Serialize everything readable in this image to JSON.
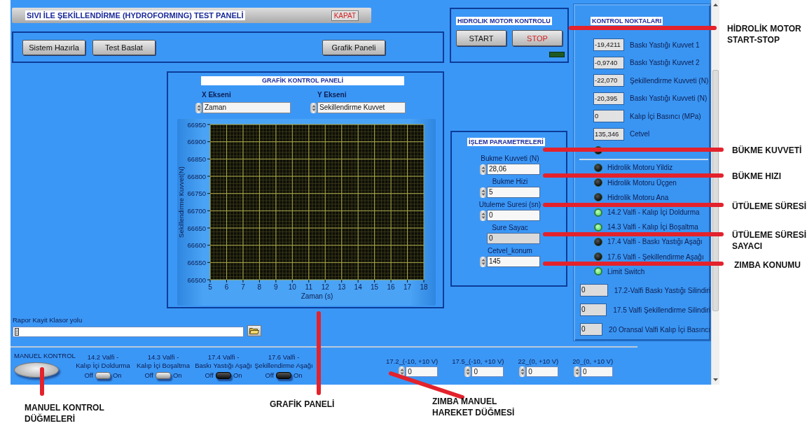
{
  "title_bar": {
    "title": "SIVI İLE ŞEKİLLENDİRME (HYDROFORMING) TEST PANELİ",
    "close_button": "KAPAT"
  },
  "toolbar_buttons": [
    "Sistem Hazırla",
    "Test Baslat",
    "Grafik Paneli"
  ],
  "motor_control": {
    "title": "HIDROLIK MOTOR KONTROLU",
    "start": "START",
    "stop": "STOP",
    "led_on": false
  },
  "control_points": {
    "title": "KONTROL NOKTALARI",
    "readouts": [
      {
        "value": "-19,4211",
        "label": "Baskı Yastığı Kuvvet 1"
      },
      {
        "value": "-0,9740",
        "label": "Baskı Yastığı Kuvvet 2"
      },
      {
        "value": "-22,070",
        "label": "Şekillendirme Kuvveti (N)"
      },
      {
        "value": "-20,395",
        "label": "Baskı Yastığı Kuvveti (N)"
      },
      {
        "value": "0",
        "label": "Kalıp İçi Basıncı (MPa)"
      },
      {
        "value": "135,346",
        "label": "Cetvel"
      }
    ],
    "first_lamp": {
      "on": false
    },
    "lamps": [
      {
        "label": "Hidrolik Motoru Yildiz",
        "on": false
      },
      {
        "label": "Hidrolik Motoru Üçgen",
        "on": false
      },
      {
        "label": "Hidrolik Motoru Ana",
        "on": false
      },
      {
        "label": "14.2 Valfi - Kalıp İçi Doldurma",
        "on": true
      },
      {
        "label": "14.3 Valfi - Kalıp İçi Boşaltma",
        "on": true
      },
      {
        "label": "17.4 Valfi - Baskı Yastığı Aşağı",
        "on": false
      },
      {
        "label": "17.6 Valfi - Şekillendirme Aşağı",
        "on": false
      },
      {
        "label": "Limit Switch",
        "on": true
      }
    ],
    "indicators": [
      {
        "value": "0",
        "label": "17.2-Valfi Baskı Yastığı Silindiri"
      },
      {
        "value": "0",
        "label": "17.5 Valfi Şekillendirme Silindiri"
      },
      {
        "value": "0",
        "label": "20 Oransal Valfi Kalıp İçi Basıncı"
      }
    ]
  },
  "graph_panel": {
    "title": "GRAFİK KONTROL PANELİ",
    "x_axis": {
      "label": "X Ekseni",
      "value": "Zaman"
    },
    "y_axis": {
      "label": "Y Ekseni",
      "value": "Sekillendirme Kuvvet"
    },
    "chart_data": {
      "type": "line",
      "grid": true,
      "xlabel": "Zaman (s)",
      "ylabel": "Sekillendirme Kuvvet(N)",
      "xlim": [
        5,
        18
      ],
      "ylim": [
        66500,
        66950
      ],
      "xticks": [
        5,
        6,
        7,
        8,
        9,
        10,
        11,
        12,
        13,
        14,
        15,
        16,
        17,
        18
      ],
      "yticks": [
        66500,
        66550,
        66600,
        66650,
        66700,
        66750,
        66800,
        66850,
        66900,
        66950
      ]
    }
  },
  "process_parameters": {
    "title": "İŞLEM PARAMETRELERİ",
    "fields": [
      {
        "label": "Bukme Kuvveti (N)",
        "value": "28,06",
        "kind": "control"
      },
      {
        "label": "Bukme Hizi",
        "value": "5",
        "kind": "control"
      },
      {
        "label": "Utuleme Suresi (sn)",
        "value": "0",
        "kind": "control"
      },
      {
        "label": "Sure Sayac",
        "value": "0",
        "kind": "indicator"
      },
      {
        "label": "Cetvel_konum",
        "value": "145",
        "kind": "control"
      }
    ]
  },
  "report_path": {
    "label": "Rapor Kayit Klasor yolu"
  },
  "manual_control": {
    "label": "MANUEL KONTROL",
    "switches": [
      {
        "label": "14.2 Valfi -\nKalıp İçi Doldurma",
        "off_label": "Off",
        "on_label": "On",
        "on": true
      },
      {
        "label": "14.3 Valfi -\nKalıp İçi Boşaltma",
        "off_label": "Off",
        "on_label": "On",
        "on": true
      },
      {
        "label": "17.4 Valfi -\nBaskı Yastığı Aşağı",
        "off_label": "Off",
        "on_label": "On",
        "on": false
      },
      {
        "label": "17.6 Valfi -\nŞekillendirme Aşağı",
        "off_label": "Off",
        "on_label": "On",
        "on": false
      }
    ]
  },
  "analog_outputs": [
    {
      "label": "17.2_(-10, +10 V)",
      "value": "0"
    },
    {
      "label": "17.5_(-10, +10 V)",
      "value": "0"
    },
    {
      "label": "22_(0, +10 V)",
      "value": "0"
    },
    {
      "label": "20_(0, +10 V)",
      "value": "0"
    }
  ],
  "annotations": [
    {
      "text": "HİDROLİK MOTOR\nSTART-STOP"
    },
    {
      "text": "BÜKME KUVVETİ"
    },
    {
      "text": "BÜKME HIZI"
    },
    {
      "text": "ÜTÜLEME SÜRESİ"
    },
    {
      "text": "ÜTÜLEME SÜRESİ\nSAYACI"
    },
    {
      "text": "ZIMBA KONUMU"
    },
    {
      "text": "GRAFİK PANELİ"
    },
    {
      "text": "MANUEL KONTROL\nDÜĞMELERİ"
    },
    {
      "text": "ZIMBA MANUEL\nHAREKET DÜĞMESİ"
    }
  ]
}
